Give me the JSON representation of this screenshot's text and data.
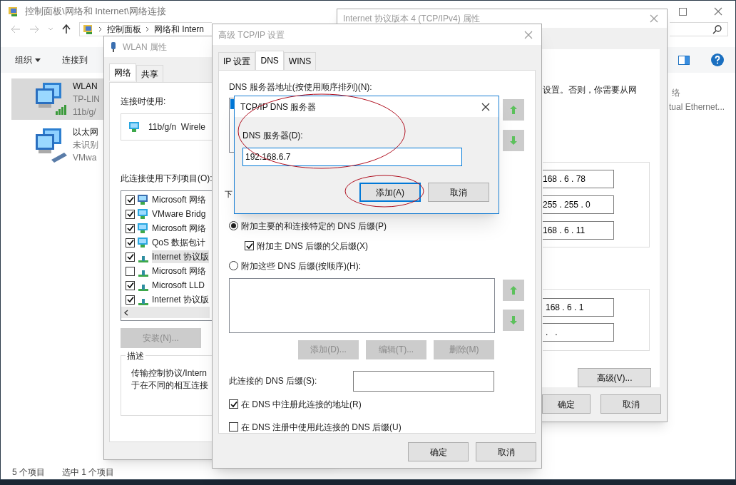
{
  "explorer": {
    "title": "控制面板\\网络和 Internet\\网络连接",
    "breadcrumb": [
      "控制面板",
      "网络和 Intern"
    ],
    "toolbar": [
      "组织",
      "连接到"
    ],
    "connections": [
      {
        "kind": "wifi",
        "name": "WLAN",
        "line2": "TP-LIN",
        "line3": "11b/g/",
        "selected": true
      },
      {
        "kind": "ethernet",
        "name": "以太网",
        "line2": "未识别",
        "line3": "VMwa",
        "selected": false
      }
    ],
    "partial_item": {
      "name": "络",
      "line2": "tual Ethernet..."
    },
    "status": [
      "5 个项目",
      "选中 1 个项目"
    ]
  },
  "ipv4_window": {
    "title": "Internet 协议版本 4 (TCP/IPv4) 属性",
    "intro": "设置。否则，你需要从网",
    "address_fields": [
      "168 . 6 . 78",
      "255 . 255 . 0",
      "168 . 6 . 11"
    ],
    "dns_fields": [
      "168 . 6 . 1",
      ".   ."
    ],
    "advanced_button": "高级(V)...",
    "buttons": [
      "确定",
      "取消"
    ]
  },
  "wlan_window": {
    "title": "WLAN 属性",
    "tabs": [
      {
        "label": "网络",
        "selected": true
      },
      {
        "label": "共享",
        "selected": false
      }
    ],
    "connect_using_label": "连接时使用:",
    "adapter": "11b/g/n  Wirele",
    "items_label": "此连接使用下列项目(O):",
    "items": [
      {
        "kind": "client",
        "label": "Microsoft 网络",
        "checked": true,
        "selected": false
      },
      {
        "kind": "service",
        "label": "VMware Bridg",
        "checked": true,
        "selected": false
      },
      {
        "kind": "service",
        "label": "Microsoft 网络",
        "checked": true,
        "selected": false
      },
      {
        "kind": "service",
        "label": "QoS 数据包计",
        "checked": true,
        "selected": false
      },
      {
        "kind": "protocol",
        "label": "Internet 协议版",
        "checked": true,
        "selected": true
      },
      {
        "kind": "protocol",
        "label": "Microsoft 网络",
        "checked": false,
        "selected": false
      },
      {
        "kind": "protocol",
        "label": "Microsoft LLD",
        "checked": true,
        "selected": false
      },
      {
        "kind": "protocol",
        "label": "Internet 协议版",
        "checked": true,
        "selected": false
      }
    ],
    "install_button": {
      "label": "安装(N)...",
      "disabled": true
    },
    "description_title": "描述",
    "description_lines": [
      "传输控制协议/Intern",
      "于在不同的相互连接"
    ]
  },
  "advanced_window": {
    "title": "高级 TCP/IP 设置",
    "tabs": [
      {
        "label": "IP 设置",
        "selected": false
      },
      {
        "label": "DNS",
        "selected": true
      },
      {
        "label": "WINS",
        "selected": false
      }
    ],
    "dns_list_label": "DNS 服务器地址(按使用顺序排列)(N):",
    "hidden_label": "下",
    "radio_primary": {
      "label": "附加主要的和连接特定的 DNS 后缀(P)",
      "selected": true
    },
    "parent_suffix": {
      "label": "附加主 DNS 后缀的父后缀(X)",
      "checked": true
    },
    "radio_these": {
      "label": "附加这些 DNS 后缀(按顺序)(H):",
      "selected": false
    },
    "suffix_buttons": [
      {
        "label": "添加(D)...",
        "disabled": true
      },
      {
        "label": "编辑(T)...",
        "disabled": true
      },
      {
        "label": "删除(M)",
        "disabled": true
      }
    ],
    "suffix_label": "此连接的 DNS 后缀(S):",
    "register_address": {
      "label": "在 DNS 中注册此连接的地址(R)",
      "checked": true
    },
    "register_suffix": {
      "label": "在 DNS 注册中使用此连接的 DNS 后缀(U)",
      "checked": false
    },
    "buttons": [
      "确定",
      "取消"
    ]
  },
  "dns_dialog": {
    "title": "TCP/IP DNS 服务器",
    "label": "DNS 服务器(D):",
    "value": "192.168.6.7",
    "buttons": [
      {
        "label": "添加(A)",
        "default": true
      },
      {
        "label": "取消",
        "default": false
      }
    ]
  }
}
